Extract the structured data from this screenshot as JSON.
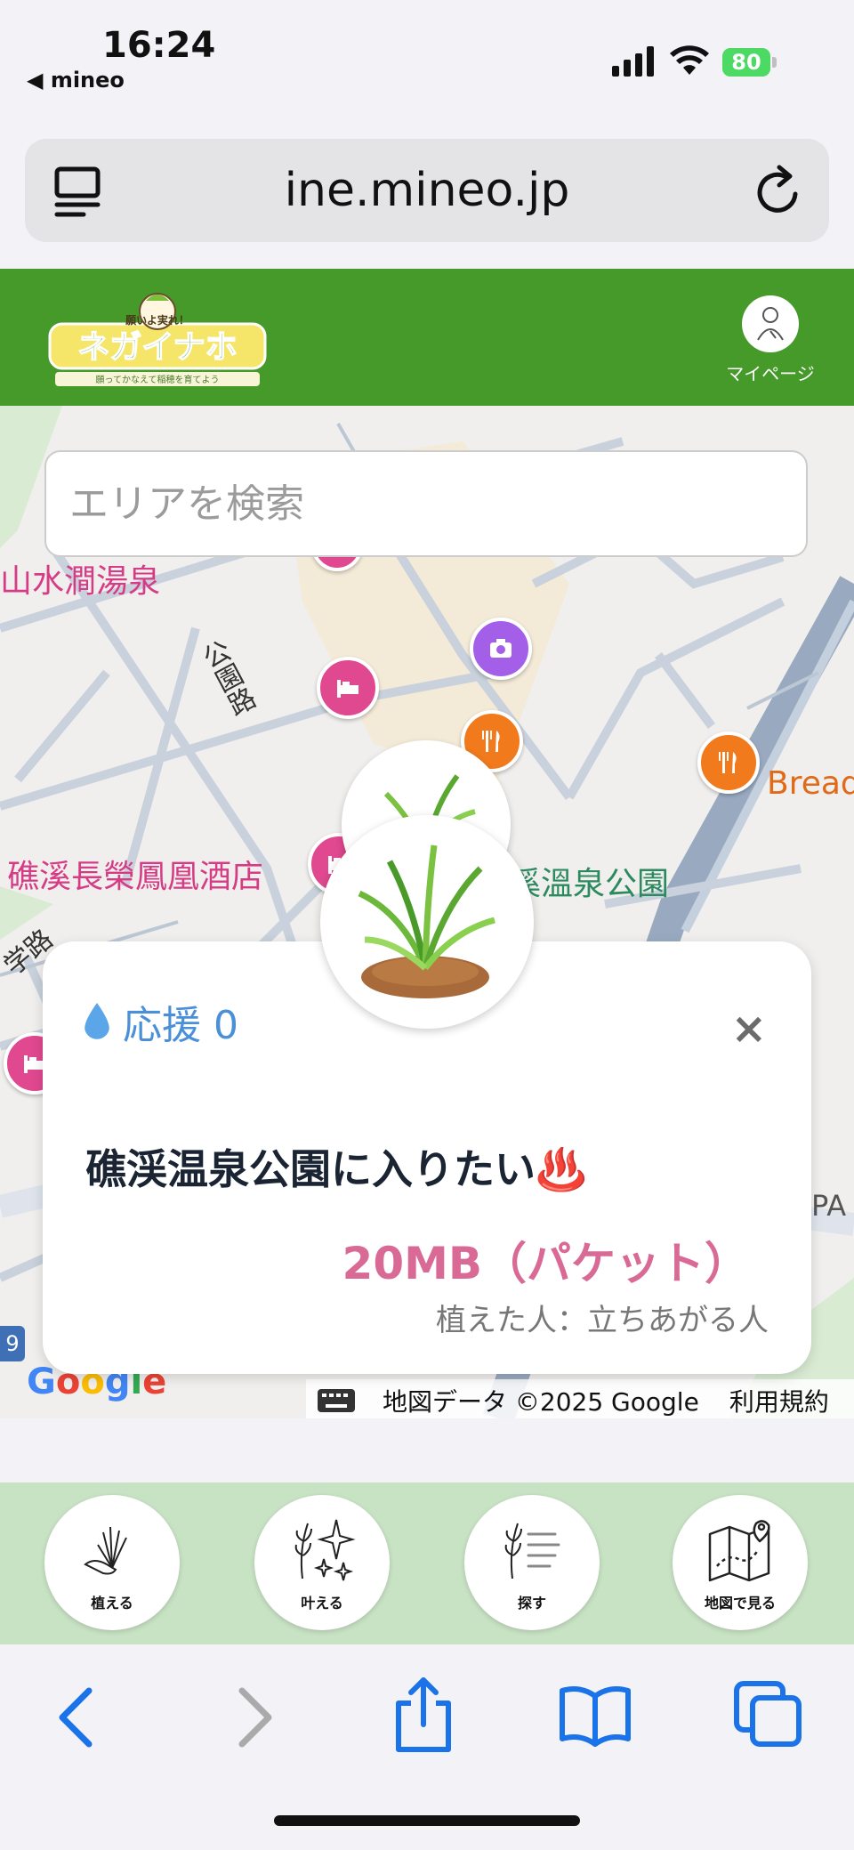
{
  "status_bar": {
    "time": "16:24",
    "back_app": "◀ mineo",
    "battery": "80"
  },
  "browser": {
    "url": "ine.mineo.jp"
  },
  "app_header": {
    "logo_text": "ネガイナホ",
    "logo_tagline": "願いよ実れ！",
    "logo_subtitle": "願ってかなえて稲穂を育てよう",
    "mypage_label": "マイページ"
  },
  "map": {
    "search_placeholder": "エリアを検索",
    "labels": {
      "hot_spring": "山水澗湯泉",
      "road": "公園路",
      "hotel": "礁溪長榮鳳凰酒店",
      "park": "溪溫泉公園",
      "bread": "Bread",
      "road_left": "学路",
      "pa": "PA",
      "road_num": "9"
    },
    "google_logo": "Google",
    "map_data": "地図データ ©2025 Google",
    "terms": "利用規約"
  },
  "card": {
    "support_label": "応援 0",
    "close_label": "×",
    "title": "礁渓温泉公園に入りたい♨️",
    "reward": "20MB（パケット）",
    "planter": "植えた人：立ちあがる人"
  },
  "app_nav": {
    "items": [
      {
        "label": "植える"
      },
      {
        "label": "叶える"
      },
      {
        "label": "探す"
      },
      {
        "label": "地図で見る"
      }
    ]
  },
  "colors": {
    "header_green": "#469a2a",
    "nav_green": "#c8e2c4",
    "support_blue": "#4a90d9",
    "reward_pink": "#d86a95",
    "safari_blue": "#1a73e8"
  }
}
